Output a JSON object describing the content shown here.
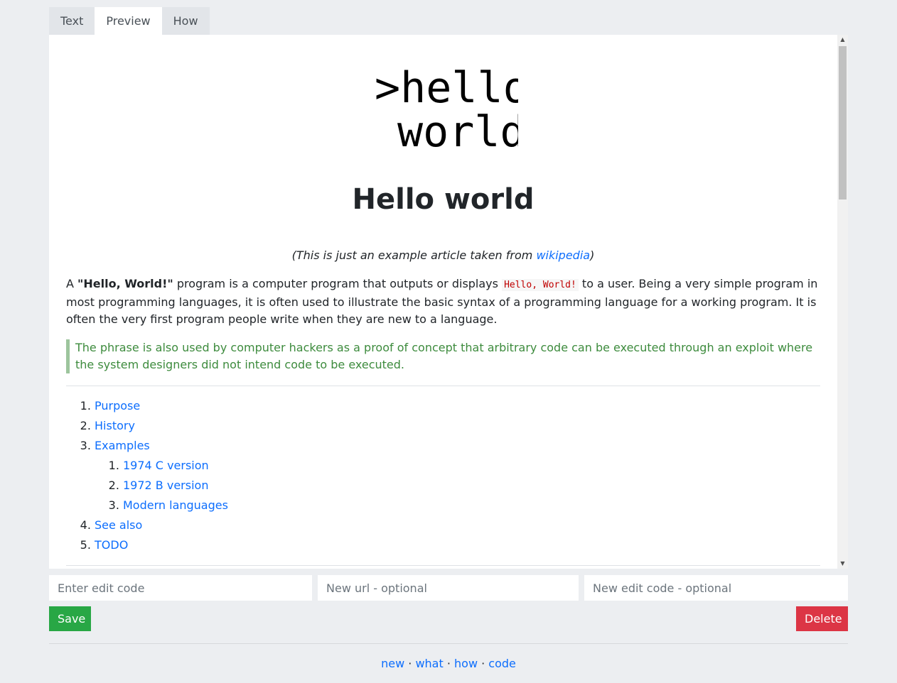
{
  "tabs": [
    {
      "label": "Text",
      "active": false
    },
    {
      "label": "Preview",
      "active": true
    },
    {
      "label": "How",
      "active": false
    }
  ],
  "article": {
    "logo_lines": [
      ">hello",
      "world"
    ],
    "title": "Hello world",
    "note": {
      "prefix": "(This is just an example article taken from ",
      "link": "wikipedia",
      "suffix": ")"
    },
    "intro": {
      "a": "A ",
      "bold": "\"Hello, World!\"",
      "b": " program is a computer program that outputs or displays ",
      "code": "Hello, World!",
      "c": " to a user. Being a very simple program in most programming languages, it is often used to illustrate the basic syntax of a programming language for a working program. It is often the very first program people write when they are new to a language."
    },
    "blockquote": "The phrase is also used by computer hackers as a proof of concept that arbitrary code can be executed through an exploit where the system designers did not intend code to be executed.",
    "toc": {
      "purpose": "Purpose",
      "history": "History",
      "examples": "Examples",
      "sub": {
        "c1974": "1974 C version",
        "b1972": "1972 B version",
        "modern": "Modern languages"
      },
      "see_also": "See also",
      "todo": "TODO"
    }
  },
  "form": {
    "edit_code_placeholder": "Enter edit code",
    "new_url_placeholder": "New url - optional",
    "new_edit_code_placeholder": "New edit code - optional",
    "save_label": "Save",
    "delete_label": "Delete"
  },
  "footer": {
    "new": "new",
    "what": "what",
    "how": "how",
    "code": "code",
    "separator": " · "
  },
  "colors": {
    "save": "#28a745",
    "delete": "#dc3545",
    "link": "#0d6efd",
    "quote": "#3d8b3d"
  }
}
